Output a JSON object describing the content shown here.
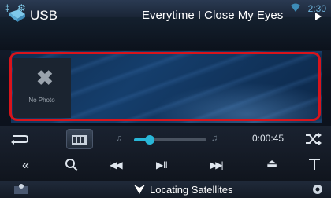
{
  "statusbar": {
    "left_icons": "‡ ⚙",
    "time": "2:30"
  },
  "header": {
    "source_label": "USB",
    "track_title": "Everytime I Close My Eyes"
  },
  "art": {
    "placeholder_text": "No Photo",
    "placeholder_glyph": "✖"
  },
  "playback": {
    "elapsed": "0:00:45",
    "progress": 0.22
  },
  "status": {
    "text": "Locating Satellites"
  }
}
